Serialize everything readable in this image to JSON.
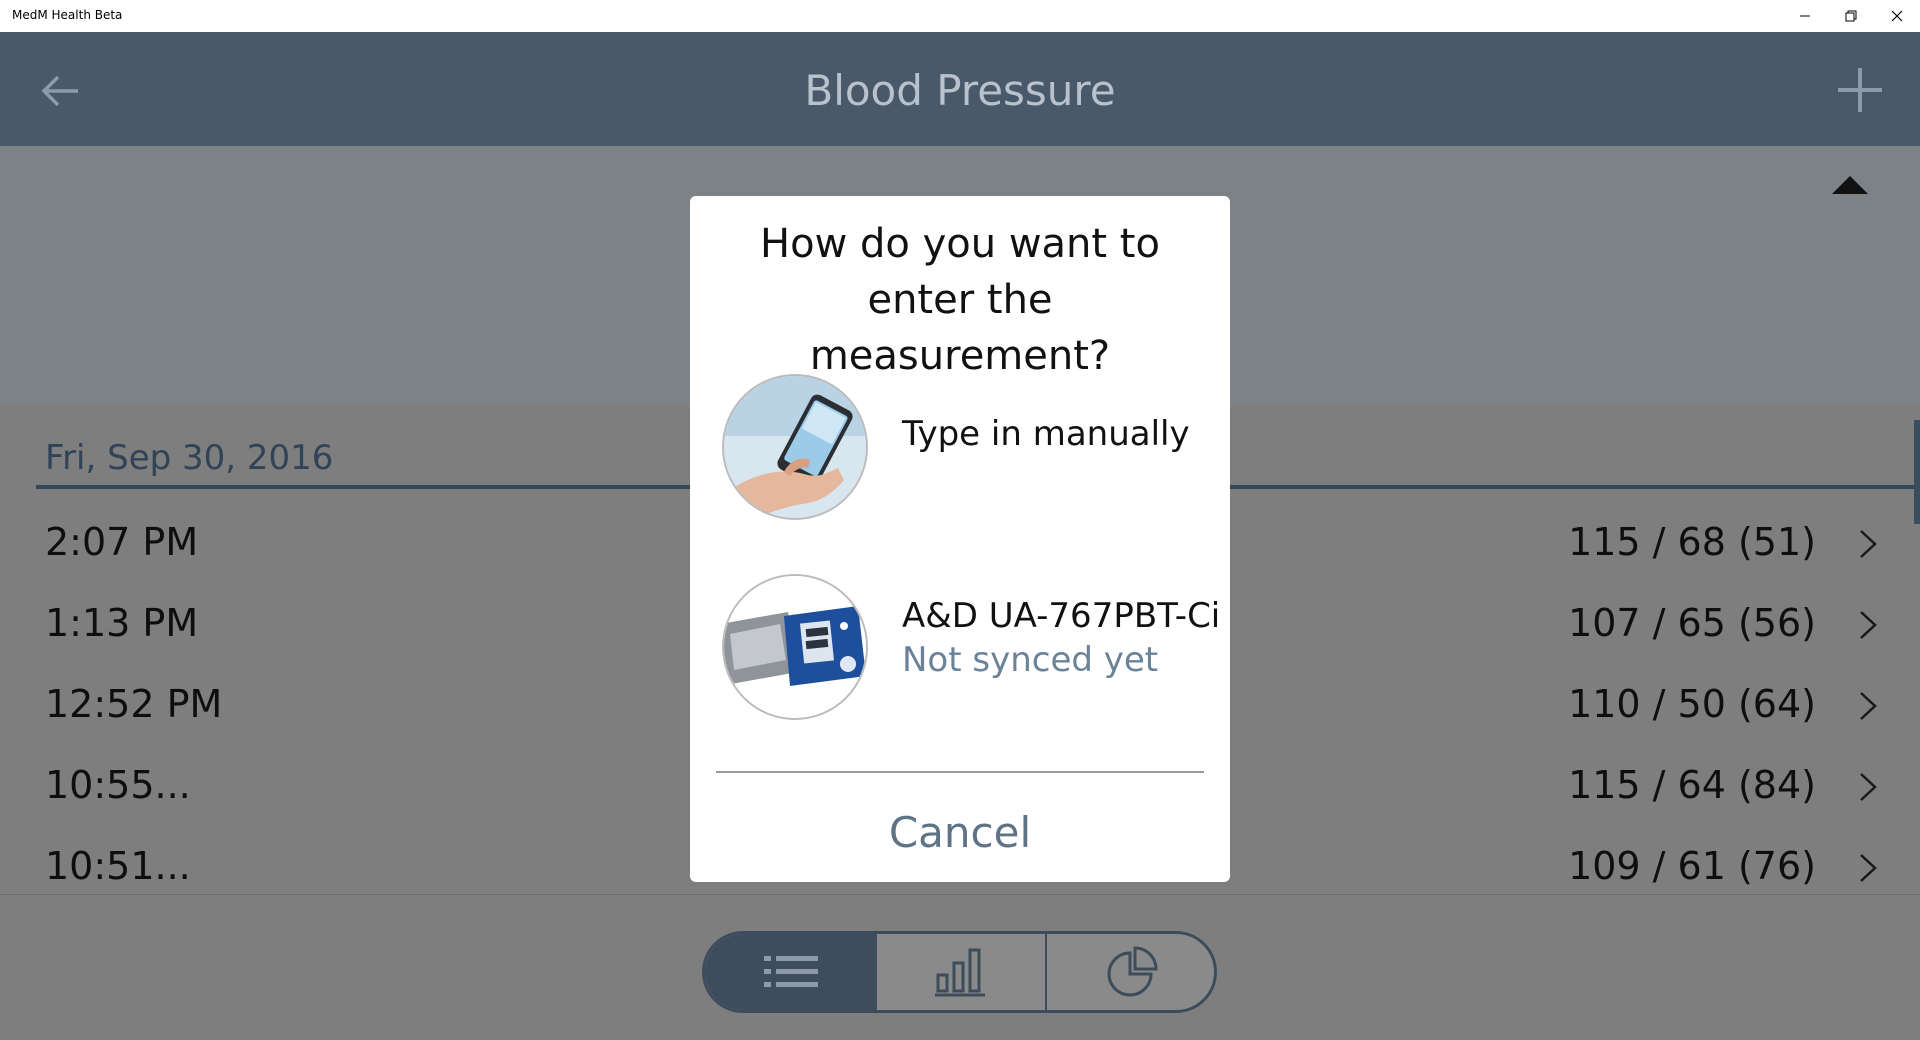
{
  "window": {
    "title": "MedM Health Beta",
    "controls": [
      "minimize-icon",
      "restore-icon",
      "close-icon"
    ]
  },
  "header": {
    "title": "Blood Pressure",
    "back_icon": "back-arrow-icon",
    "add_icon": "plus-icon"
  },
  "summary": {
    "collapse_icon": "triangle-up-icon"
  },
  "list": {
    "date": "Fri, Sep 30, 2016",
    "rows": [
      {
        "time": "2:07 PM",
        "value": "115 / 68 (51)"
      },
      {
        "time": "1:13 PM",
        "value": "107 / 65 (56)"
      },
      {
        "time": "12:52 PM",
        "value": "110 / 50 (64)"
      },
      {
        "time": "10:55...",
        "value": "115 / 64 (84)"
      },
      {
        "time": "10:51...",
        "value": "109 / 61 (76)"
      }
    ]
  },
  "bottom_tabs": [
    {
      "icon": "list-icon",
      "selected": true
    },
    {
      "icon": "bar-chart-icon",
      "selected": false
    },
    {
      "icon": "pie-chart-icon",
      "selected": false
    }
  ],
  "dialog": {
    "question": "How do you want to enter the measurement?",
    "option_manual": {
      "label": "Type in manually",
      "image": "phone-hand-image"
    },
    "option_device": {
      "label": "A&D UA-767PBT-Ci",
      "status": "Not synced yet",
      "image": "blood-pressure-monitor-image"
    },
    "cancel_label": "Cancel"
  },
  "colors": {
    "header_bg": "#4a5969",
    "overlay_gray": "#7e7e7e",
    "accent_text": "#6a8399"
  }
}
